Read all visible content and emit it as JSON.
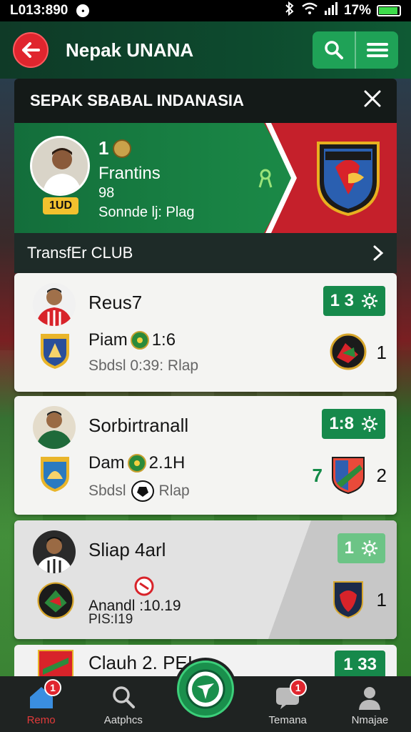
{
  "status_bar": {
    "time": "L013:890",
    "notif": "•",
    "battery": "17%"
  },
  "app_bar": {
    "title": "Nepak UNANA"
  },
  "panel": {
    "title": "SEPAK SBABAL INDANASIA",
    "featured": {
      "number": "1",
      "badge": "1UD",
      "name": "Frantins",
      "sub1": "98",
      "sub2": "Sonnde lj: Plag"
    },
    "transfer_label": "TransfEr CLUB"
  },
  "matches": [
    {
      "title": "Reus7",
      "line1_a": "Piam",
      "line1_b": "1:6",
      "line2": "Sbdsl 0:39: Rlap",
      "score": "1 3",
      "opp_score": "1"
    },
    {
      "title": "Sorbirtranall",
      "line1_a": "Dam",
      "line1_b": "2.1H",
      "line2_a": "Sbdsl",
      "line2_b": "Rlap",
      "score": "1:8",
      "extra_score": "7",
      "opp_score": "2"
    },
    {
      "title": "Sliap 4arl",
      "line1": "Anandl :10.19",
      "line2": "PIS:I19",
      "score": "1",
      "opp_score": "1"
    },
    {
      "title": "Clauh 2. PEI",
      "score": "1 33"
    }
  ],
  "bottom_nav": [
    {
      "label": "Remo",
      "badge": "1"
    },
    {
      "label": "Aatphcs"
    },
    {
      "label": "Temana",
      "badge": "1"
    },
    {
      "label": "Nmajae"
    }
  ],
  "colors": {
    "brand_green": "#16894b",
    "accent_red": "#e0252e",
    "header_dark": "#141a18"
  }
}
